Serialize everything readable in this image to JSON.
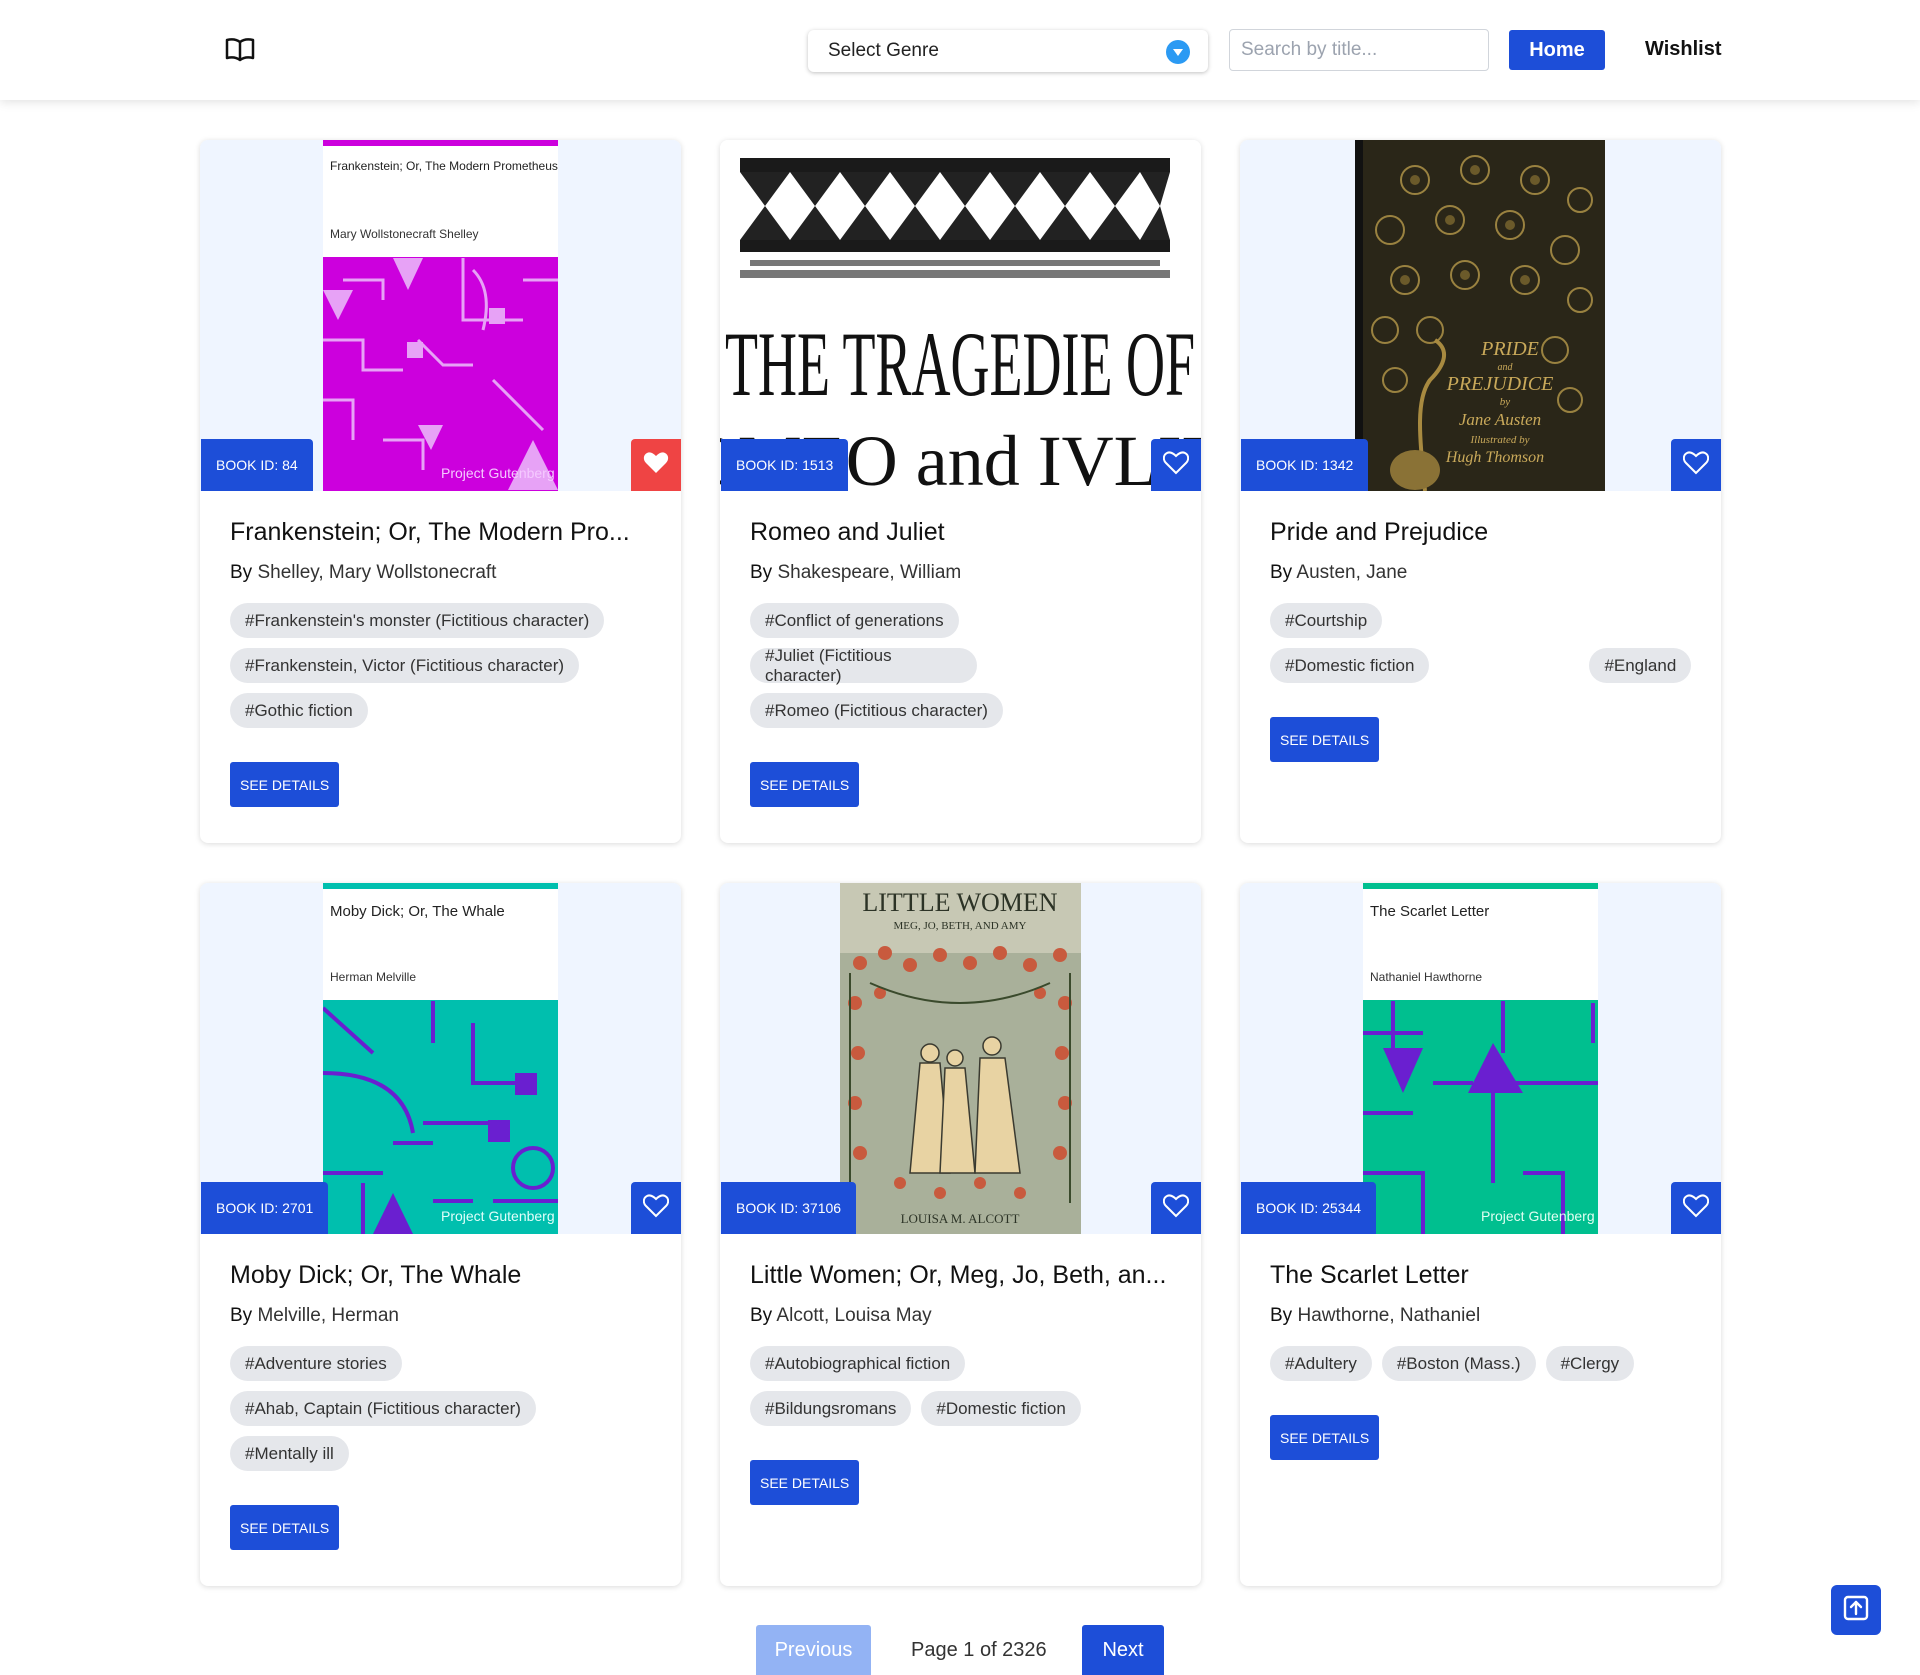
{
  "header": {
    "genre_select": "Select Genre",
    "search_placeholder": "Search by title...",
    "home_label": "Home",
    "wishlist_label": "Wishlist"
  },
  "books": [
    {
      "id_label": "BOOK ID: 84",
      "title": "Frankenstein; Or, The Modern Pro...",
      "by": "By",
      "author": "Shelley, Mary Wollstonecraft",
      "tags": [
        "#Frankenstein's monster (Fictitious character)",
        "#Frankenstein, Victor (Fictitious character)",
        "#Gothic fiction"
      ],
      "details_label": "SEE DETAILS",
      "wishlisted": true,
      "cover": {
        "title": "Frankenstein; Or, The Modern Prometheus",
        "author": "Mary Wollstonecraft Shelley",
        "publisher": "Project Gutenberg"
      }
    },
    {
      "id_label": "BOOK ID: 1513",
      "title": "Romeo and Juliet",
      "by": "By",
      "author": "Shakespeare, William",
      "tags": [
        "#Conflict of generations",
        "#Juliet (Fictitious character)",
        "#Romeo (Fictitious character)"
      ],
      "details_label": "SEE DETAILS",
      "wishlisted": false,
      "cover": {
        "line1": "THE TRAGEDIE OF",
        "line2": "ROMEO and IVLIET."
      }
    },
    {
      "id_label": "BOOK ID: 1342",
      "title": "Pride and Prejudice",
      "by": "By",
      "author": "Austen, Jane",
      "tags": [
        "#Courtship",
        "#Domestic fiction",
        "#England"
      ],
      "details_label": "SEE DETAILS",
      "wishlisted": false,
      "cover": {
        "line1": "PRIDE",
        "line2": "and",
        "line3": "PREJUDICE",
        "line4": "by",
        "line5": "Jane Austen",
        "line6": "Illustrated by",
        "line7": "Hugh Thomson"
      }
    },
    {
      "id_label": "BOOK ID: 2701",
      "title": "Moby Dick; Or, The Whale",
      "by": "By",
      "author": "Melville, Herman",
      "tags": [
        "#Adventure stories",
        "#Ahab, Captain (Fictitious character)",
        "#Mentally ill"
      ],
      "details_label": "SEE DETAILS",
      "wishlisted": false,
      "cover": {
        "title": "Moby Dick; Or, The Whale",
        "author": "Herman Melville",
        "publisher": "Project Gutenberg"
      }
    },
    {
      "id_label": "BOOK ID: 37106",
      "title": "Little Women; Or, Meg, Jo, Beth, an...",
      "by": "By",
      "author": "Alcott, Louisa May",
      "tags": [
        "#Autobiographical fiction",
        "#Bildungsromans",
        "#Domestic fiction"
      ],
      "details_label": "SEE DETAILS",
      "wishlisted": false,
      "cover": {
        "title": "LITTLE WOMEN",
        "subtitle": "MEG, JO, BETH, AND AMY",
        "author": "LOUISA M. ALCOTT"
      }
    },
    {
      "id_label": "BOOK ID: 25344",
      "title": "The Scarlet Letter",
      "by": "By",
      "author": "Hawthorne, Nathaniel",
      "tags": [
        "#Adultery",
        "#Boston (Mass.)",
        "#Clergy"
      ],
      "details_label": "SEE DETAILS",
      "wishlisted": false,
      "cover": {
        "title": "The Scarlet Letter",
        "author": "Nathaniel Hawthorne",
        "publisher": "Project Gutenberg"
      }
    }
  ],
  "pagination": {
    "previous_label": "Previous",
    "page_label": "Page 1 of 2326",
    "next_label": "Next"
  },
  "colors": {
    "primary": "#1d4ed8",
    "wishlisted": "#ef4444",
    "cover_bg": "#eff5ff",
    "magenta": "#cc00dd",
    "teal": "#00bfae",
    "tag_bg": "#e5e7eb"
  },
  "icons": {
    "logo": "open-book-icon",
    "genre": "chevron-down-icon",
    "wishlist": "heart-icon",
    "scroll_top": "arrow-up-icon"
  }
}
